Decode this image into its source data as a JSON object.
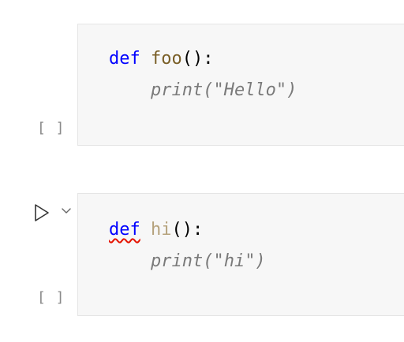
{
  "cells": [
    {
      "execution_count": "[ ]",
      "line1": {
        "keyword": "def",
        "name": "foo",
        "parens": "()",
        "colon": ":"
      },
      "line2": {
        "indent": "    ",
        "text": "print(\"Hello\")"
      }
    },
    {
      "execution_count": "[ ]",
      "line1": {
        "keyword": "def",
        "name": "hi",
        "parens": "()",
        "colon": ":"
      },
      "line2": {
        "indent": "    ",
        "text": "print(\"hi\")"
      }
    }
  ],
  "icons": {
    "run": "run-cell-icon",
    "chevron": "chevron-down-icon"
  },
  "colors": {
    "keyword": "#0000ff",
    "function_name": "#795e26",
    "function_name_dim": "#b5a27c",
    "error_squiggle": "#e51400"
  }
}
